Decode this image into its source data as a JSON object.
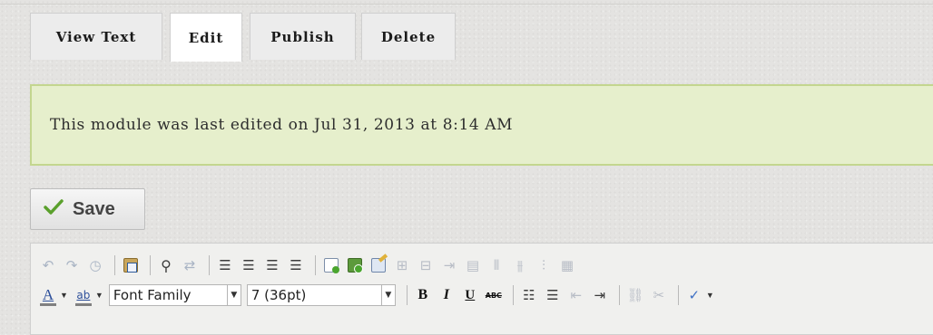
{
  "tabs": [
    {
      "label": "View Text",
      "active": false
    },
    {
      "label": "Edit",
      "active": true
    },
    {
      "label": "Publish",
      "active": false
    },
    {
      "label": "Delete",
      "active": false
    }
  ],
  "notice": {
    "text": "This module was last edited on Jul 31, 2013 at 8:14 AM"
  },
  "save_button": {
    "label": "Save",
    "icon": "checkmark-icon"
  },
  "toolbar": {
    "font_family": "Font Family",
    "font_size": "7 (36pt)",
    "bold": "B",
    "italic": "I",
    "underline": "U",
    "strikethrough": "ABC",
    "text_color_glyph": "A",
    "highlight_glyph": "ab"
  },
  "colors": {
    "notice_bg": "#e6efcc",
    "notice_border": "#c3d68f",
    "text_color_bar": "#808080",
    "check_green": "#5aa02c"
  }
}
